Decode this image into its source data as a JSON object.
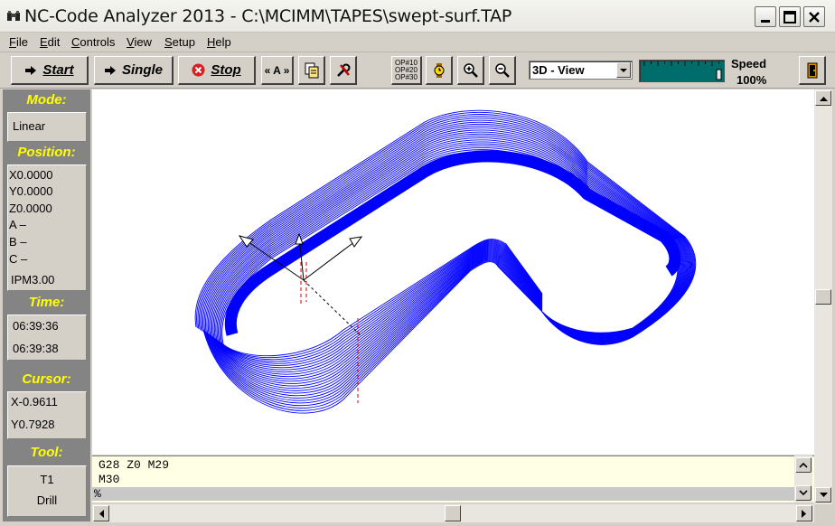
{
  "window": {
    "title": "NC-Code Analyzer 2013 - C:\\MCIMM\\TAPES\\swept-surf.TAP",
    "minimize_icon": "minimize-icon",
    "maximize_icon": "maximize-icon",
    "close_icon": "close-icon"
  },
  "menu": {
    "items": [
      {
        "first": "F",
        "rest": "ile"
      },
      {
        "first": "E",
        "rest": "dit"
      },
      {
        "first": "C",
        "rest": "ontrols"
      },
      {
        "first": "V",
        "rest": "iew"
      },
      {
        "first": "S",
        "rest": "etup"
      },
      {
        "first": "H",
        "rest": "elp"
      }
    ]
  },
  "toolbar": {
    "start_label": "Start",
    "single_label": "Single",
    "stop_label": "Stop",
    "axis_label": "« A »",
    "op_lines": [
      "OP#10",
      "OP#20",
      "OP#30"
    ],
    "view_select": "3D - View",
    "speed_label": "Speed",
    "speed_value": "100%",
    "speed_fraction": 1.0
  },
  "panel": {
    "mode_label": "Mode:",
    "mode_value": "Linear",
    "position_label": "Position:",
    "position_lines": [
      "X0.0000",
      "Y0.0000",
      "Z0.0000",
      "A –",
      "B –",
      "C –"
    ],
    "feed_value": "IPM3.00",
    "time_label": "Time:",
    "time_values": [
      "06:39:36",
      "06:39:38"
    ],
    "cursor_label": "Cursor:",
    "cursor_values": [
      "X-0.9611",
      "Y0.7928"
    ],
    "tool_label": "Tool:",
    "tool_values": [
      "T1",
      "Drill"
    ]
  },
  "code": {
    "lines": [
      "G28 Z0 M29",
      "M30",
      "%"
    ],
    "selected_index": 2
  },
  "colors": {
    "toolpath": "#0000ff",
    "panel_bg": "#848484",
    "panel_labels": "#ffff00",
    "code_bg": "#ffffe6",
    "speed_track": "#006d6d"
  }
}
